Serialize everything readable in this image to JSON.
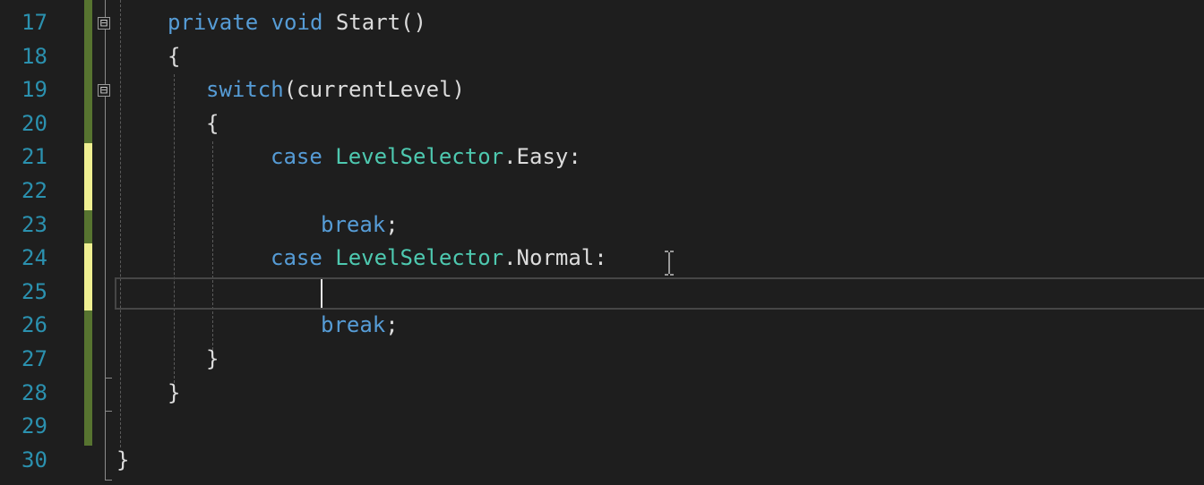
{
  "editor": {
    "colors": {
      "background": "#1e1e1e",
      "line_number": "#2b91af",
      "keyword": "#569cd6",
      "type": "#4ec9b0",
      "plain": "#dcdcdc",
      "saved_change": "#577430",
      "unsaved_change": "#efef91"
    },
    "line_numbers": [
      "17",
      "18",
      "19",
      "20",
      "21",
      "22",
      "23",
      "24",
      "25",
      "26",
      "27",
      "28",
      "29",
      "30"
    ],
    "code": {
      "l17_private": "private",
      "l17_void": "void",
      "l17_name": "Start()",
      "l18_brace": "{",
      "l19_switch": "switch",
      "l19_rest": "(currentLevel)",
      "l20_brace": "{",
      "l21_case": "case",
      "l21_type": "LevelSelector",
      "l21_member": ".Easy:",
      "l23_break": "break",
      "l23_semi": ";",
      "l24_case": "case",
      "l24_type": "LevelSelector",
      "l24_member": ".Normal:",
      "l26_break": "break",
      "l26_semi": ";",
      "l27_brace": "}",
      "l28_brace": "}",
      "l30_brace": "}"
    },
    "fold_toggle_glyph": "⊟",
    "current_line": "25",
    "mouse_cursor_icon": "i-beam-cursor-icon"
  }
}
